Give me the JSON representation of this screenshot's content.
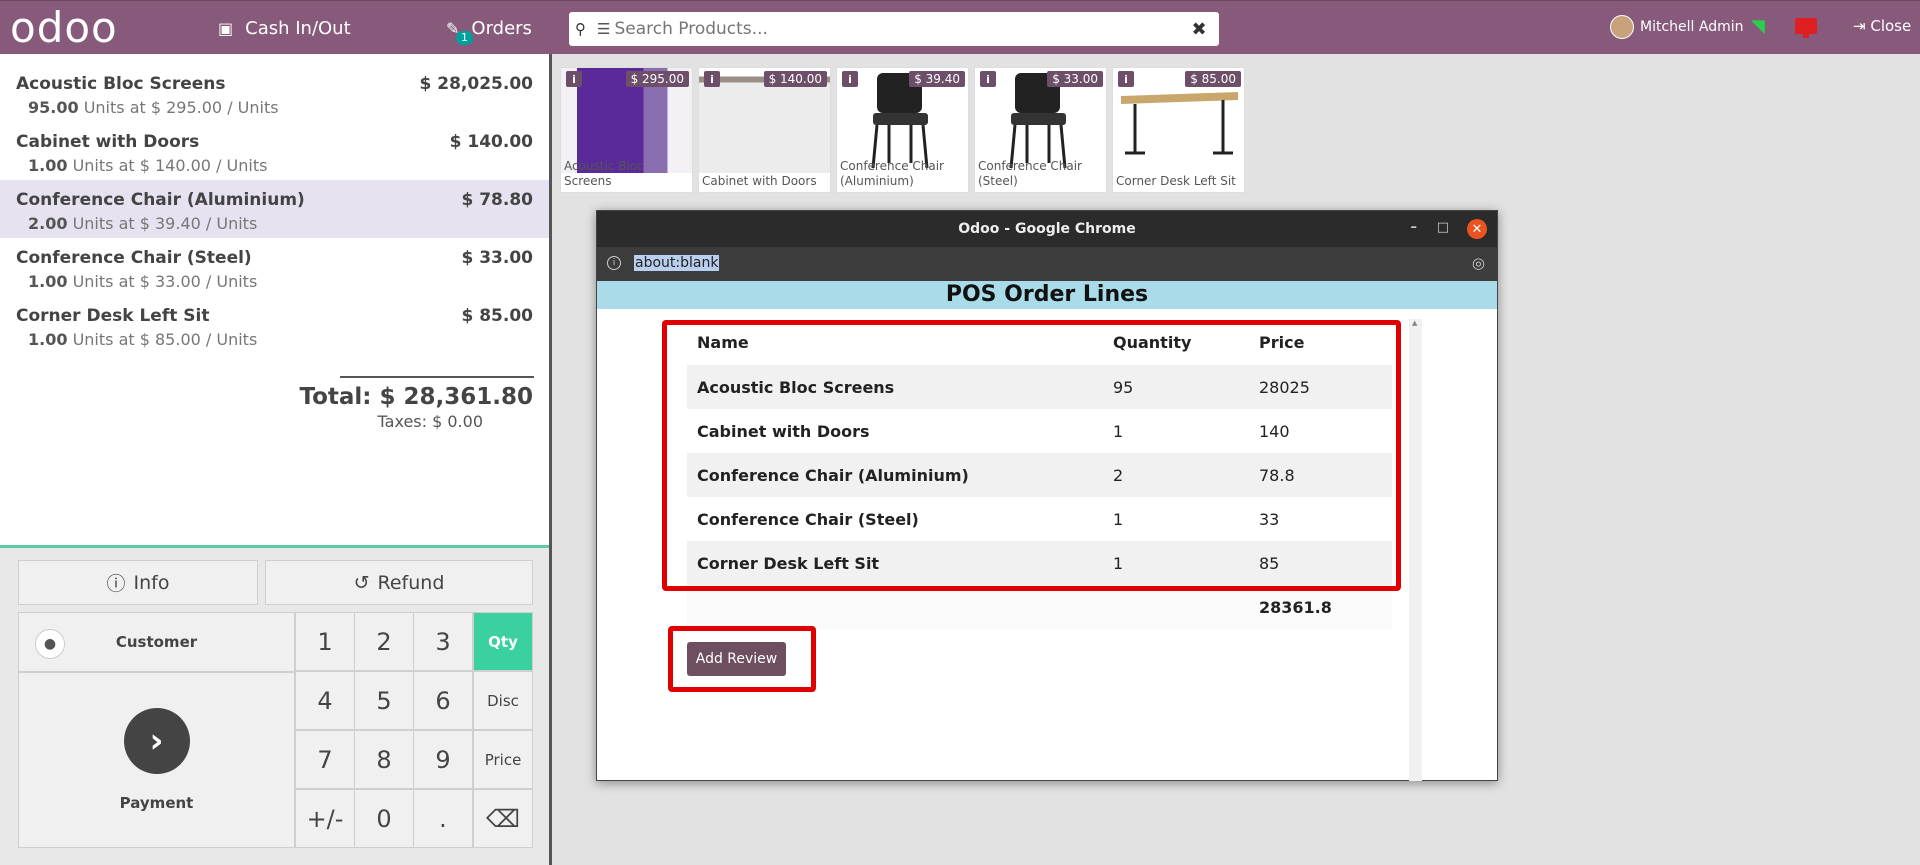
{
  "topbar": {
    "logo": "odoo",
    "cash_label": "Cash In/Out",
    "orders_label": "Orders",
    "orders_badge": "1",
    "search_placeholder": "Search Products...",
    "user_name": "Mitchell Admin",
    "close_label": "Close"
  },
  "order": {
    "lines": [
      {
        "name": "Acoustic Bloc Screens",
        "price": "$ 28,025.00",
        "qty": "95.00",
        "unit_text": "Units at $ 295.00 / Units"
      },
      {
        "name": "Cabinet with Doors",
        "price": "$ 140.00",
        "qty": "1.00",
        "unit_text": "Units at $ 140.00 / Units"
      },
      {
        "name": "Conference Chair (Aluminium)",
        "price": "$ 78.80",
        "qty": "2.00",
        "unit_text": "Units at $ 39.40 / Units"
      },
      {
        "name": "Conference Chair (Steel)",
        "price": "$ 33.00",
        "qty": "1.00",
        "unit_text": "Units at $ 33.00 / Units"
      },
      {
        "name": "Corner Desk Left Sit",
        "price": "$ 85.00",
        "qty": "1.00",
        "unit_text": "Units at $ 85.00 / Units"
      }
    ],
    "total": "Total: $ 28,361.80",
    "taxes": "Taxes: $ 0.00"
  },
  "pad": {
    "info": "Info",
    "refund": "Refund",
    "customer": "Customer",
    "payment": "Payment",
    "keys": [
      "1",
      "2",
      "3",
      "Qty",
      "4",
      "5",
      "6",
      "Disc",
      "7",
      "8",
      "9",
      "Price",
      "+/-",
      "0",
      ".",
      "⌫"
    ]
  },
  "products": [
    {
      "name": "Acoustic Bloc Screens",
      "price": "$ 295.00"
    },
    {
      "name": "Cabinet with Doors",
      "price": "$ 140.00"
    },
    {
      "name": "Conference Chair (Aluminium)",
      "price": "$ 39.40"
    },
    {
      "name": "Conference Chair (Steel)",
      "price": "$ 33.00"
    },
    {
      "name": "Corner Desk Left Sit",
      "price": "$ 85.00"
    }
  ],
  "popup": {
    "window_title": "Odoo - Google Chrome",
    "url": "about:blank",
    "header": "POS Order Lines",
    "columns": [
      "Name",
      "Quantity",
      "Price"
    ],
    "rows": [
      [
        "Acoustic Bloc Screens",
        "95",
        "28025"
      ],
      [
        "Cabinet with Doors",
        "1",
        "140"
      ],
      [
        "Conference Chair (Aluminium)",
        "2",
        "78.8"
      ],
      [
        "Conference Chair (Steel)",
        "1",
        "33"
      ],
      [
        "Corner Desk Left Sit",
        "1",
        "85"
      ]
    ],
    "total": "28361.8",
    "add_review": "Add Review"
  }
}
